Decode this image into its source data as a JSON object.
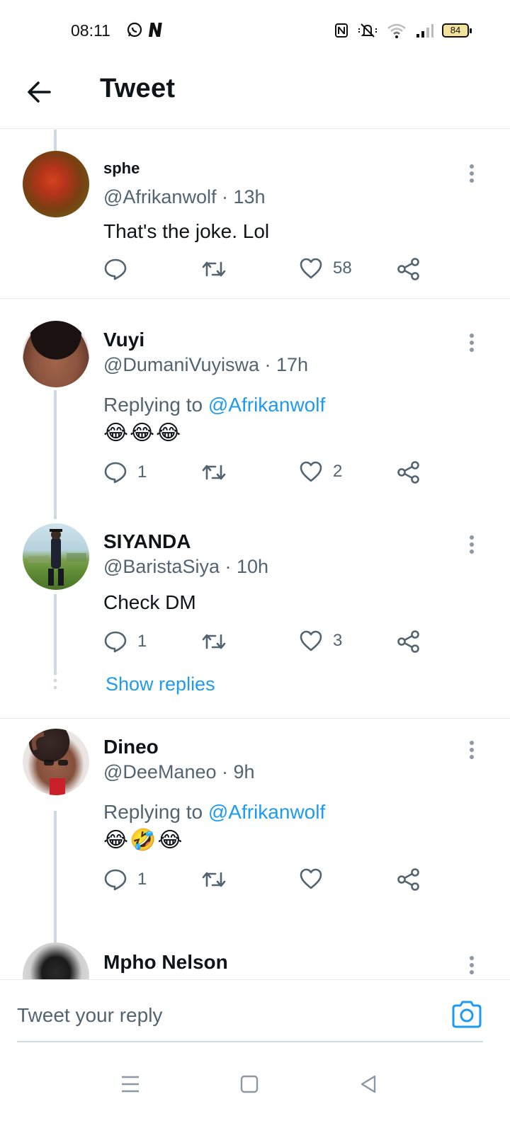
{
  "status_bar": {
    "time": "08:11",
    "battery": "84"
  },
  "header": {
    "title": "Tweet"
  },
  "tweets": [
    {
      "name": "sphe",
      "handle": "@Afrikanwolf",
      "time": "· 13h",
      "text": "That's the joke. Lol",
      "replies": "",
      "likes": "58"
    },
    {
      "name": "Vuyi",
      "handle": "@DumaniVuyiswa",
      "time": "· 17h",
      "replying_prefix": "Replying to",
      "replying_to": "@Afrikanwolf",
      "text": "😂😂😂",
      "replies": "1",
      "likes": "2"
    },
    {
      "name": "SIYANDA",
      "handle": "@BaristaSiya",
      "time": "· 10h",
      "text": "Check DM",
      "replies": "1",
      "likes": "3"
    },
    {
      "name": "Dineo",
      "handle": "@DeeManeo",
      "time": "· 9h",
      "replying_prefix": "Replying to",
      "replying_to": "@Afrikanwolf",
      "text": "😂🤣😂",
      "replies": "1",
      "likes": ""
    },
    {
      "name": "Mpho Nelson"
    }
  ],
  "show_replies": "Show replies",
  "reply_bar": {
    "placeholder": "Tweet your reply"
  },
  "colors": {
    "accent": "#1d9bf0",
    "text_primary": "#0f1419",
    "text_secondary": "#536471",
    "thread_line": "#cfd9de",
    "divider": "#e6ecf0"
  },
  "icons": {
    "back": "arrow-left-icon",
    "more": "more-vertical-icon",
    "reply": "comment-icon",
    "retweet": "retweet-icon",
    "like": "heart-icon",
    "share": "share-icon",
    "camera": "camera-icon"
  }
}
